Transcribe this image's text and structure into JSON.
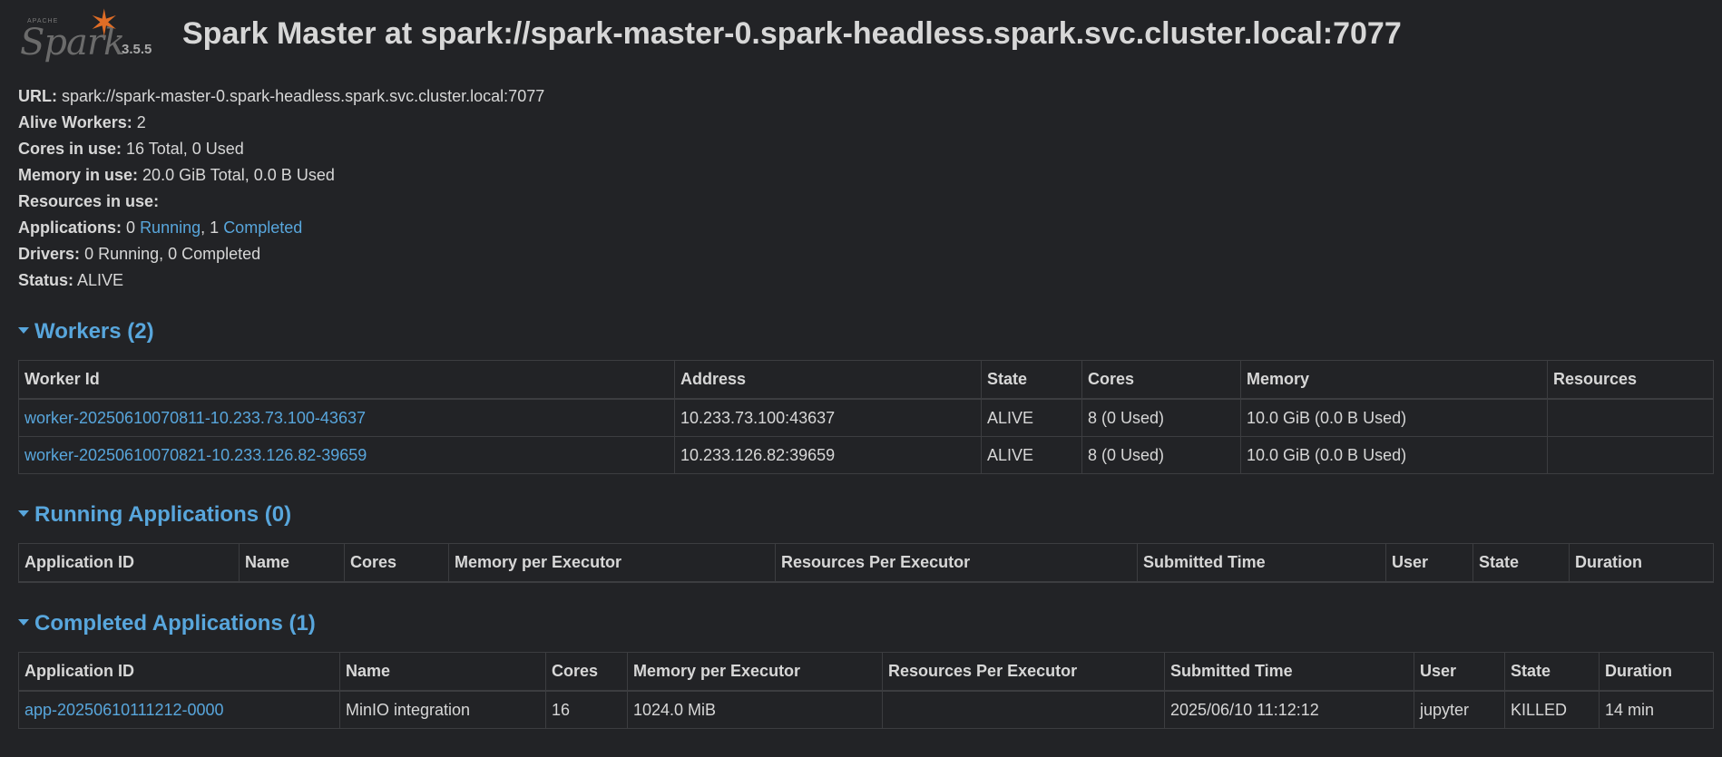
{
  "header": {
    "logo_apache": "APACHE",
    "logo_text": "Spark",
    "version": "3.5.5",
    "title": "Spark Master at spark://spark-master-0.spark-headless.spark.svc.cluster.local:7077"
  },
  "summary": {
    "url_label": "URL:",
    "url_value": "spark://spark-master-0.spark-headless.spark.svc.cluster.local:7077",
    "alive_workers_label": "Alive Workers:",
    "alive_workers_value": "2",
    "cores_label": "Cores in use:",
    "cores_value": "16 Total, 0 Used",
    "memory_label": "Memory in use:",
    "memory_value": "20.0 GiB Total, 0.0 B Used",
    "resources_label": "Resources in use:",
    "applications_label": "Applications:",
    "applications_running_count": "0",
    "applications_running_link": "Running",
    "applications_completed_count": "1",
    "applications_completed_link": "Completed",
    "drivers_label": "Drivers:",
    "drivers_value": "0 Running, 0 Completed",
    "status_label": "Status:",
    "status_value": "ALIVE"
  },
  "workers": {
    "title": "Workers (2)",
    "columns": [
      "Worker Id",
      "Address",
      "State",
      "Cores",
      "Memory",
      "Resources"
    ],
    "rows": [
      [
        "worker-20250610070811-10.233.73.100-43637",
        "10.233.73.100:43637",
        "ALIVE",
        "8 (0 Used)",
        "10.0 GiB (0.0 B Used)",
        ""
      ],
      [
        "worker-20250610070821-10.233.126.82-39659",
        "10.233.126.82:39659",
        "ALIVE",
        "8 (0 Used)",
        "10.0 GiB (0.0 B Used)",
        ""
      ]
    ]
  },
  "running_apps": {
    "title": "Running Applications (0)",
    "columns": [
      "Application ID",
      "Name",
      "Cores",
      "Memory per Executor",
      "Resources Per Executor",
      "Submitted Time",
      "User",
      "State",
      "Duration"
    ]
  },
  "completed_apps": {
    "title": "Completed Applications (1)",
    "columns": [
      "Application ID",
      "Name",
      "Cores",
      "Memory per Executor",
      "Resources Per Executor",
      "Submitted Time",
      "User",
      "State",
      "Duration"
    ],
    "rows": [
      [
        "app-20250610111212-0000",
        "MinIO integration",
        "16",
        "1024.0 MiB",
        "",
        "2025/06/10 11:12:12",
        "jupyter",
        "KILLED",
        "14 min"
      ]
    ]
  }
}
